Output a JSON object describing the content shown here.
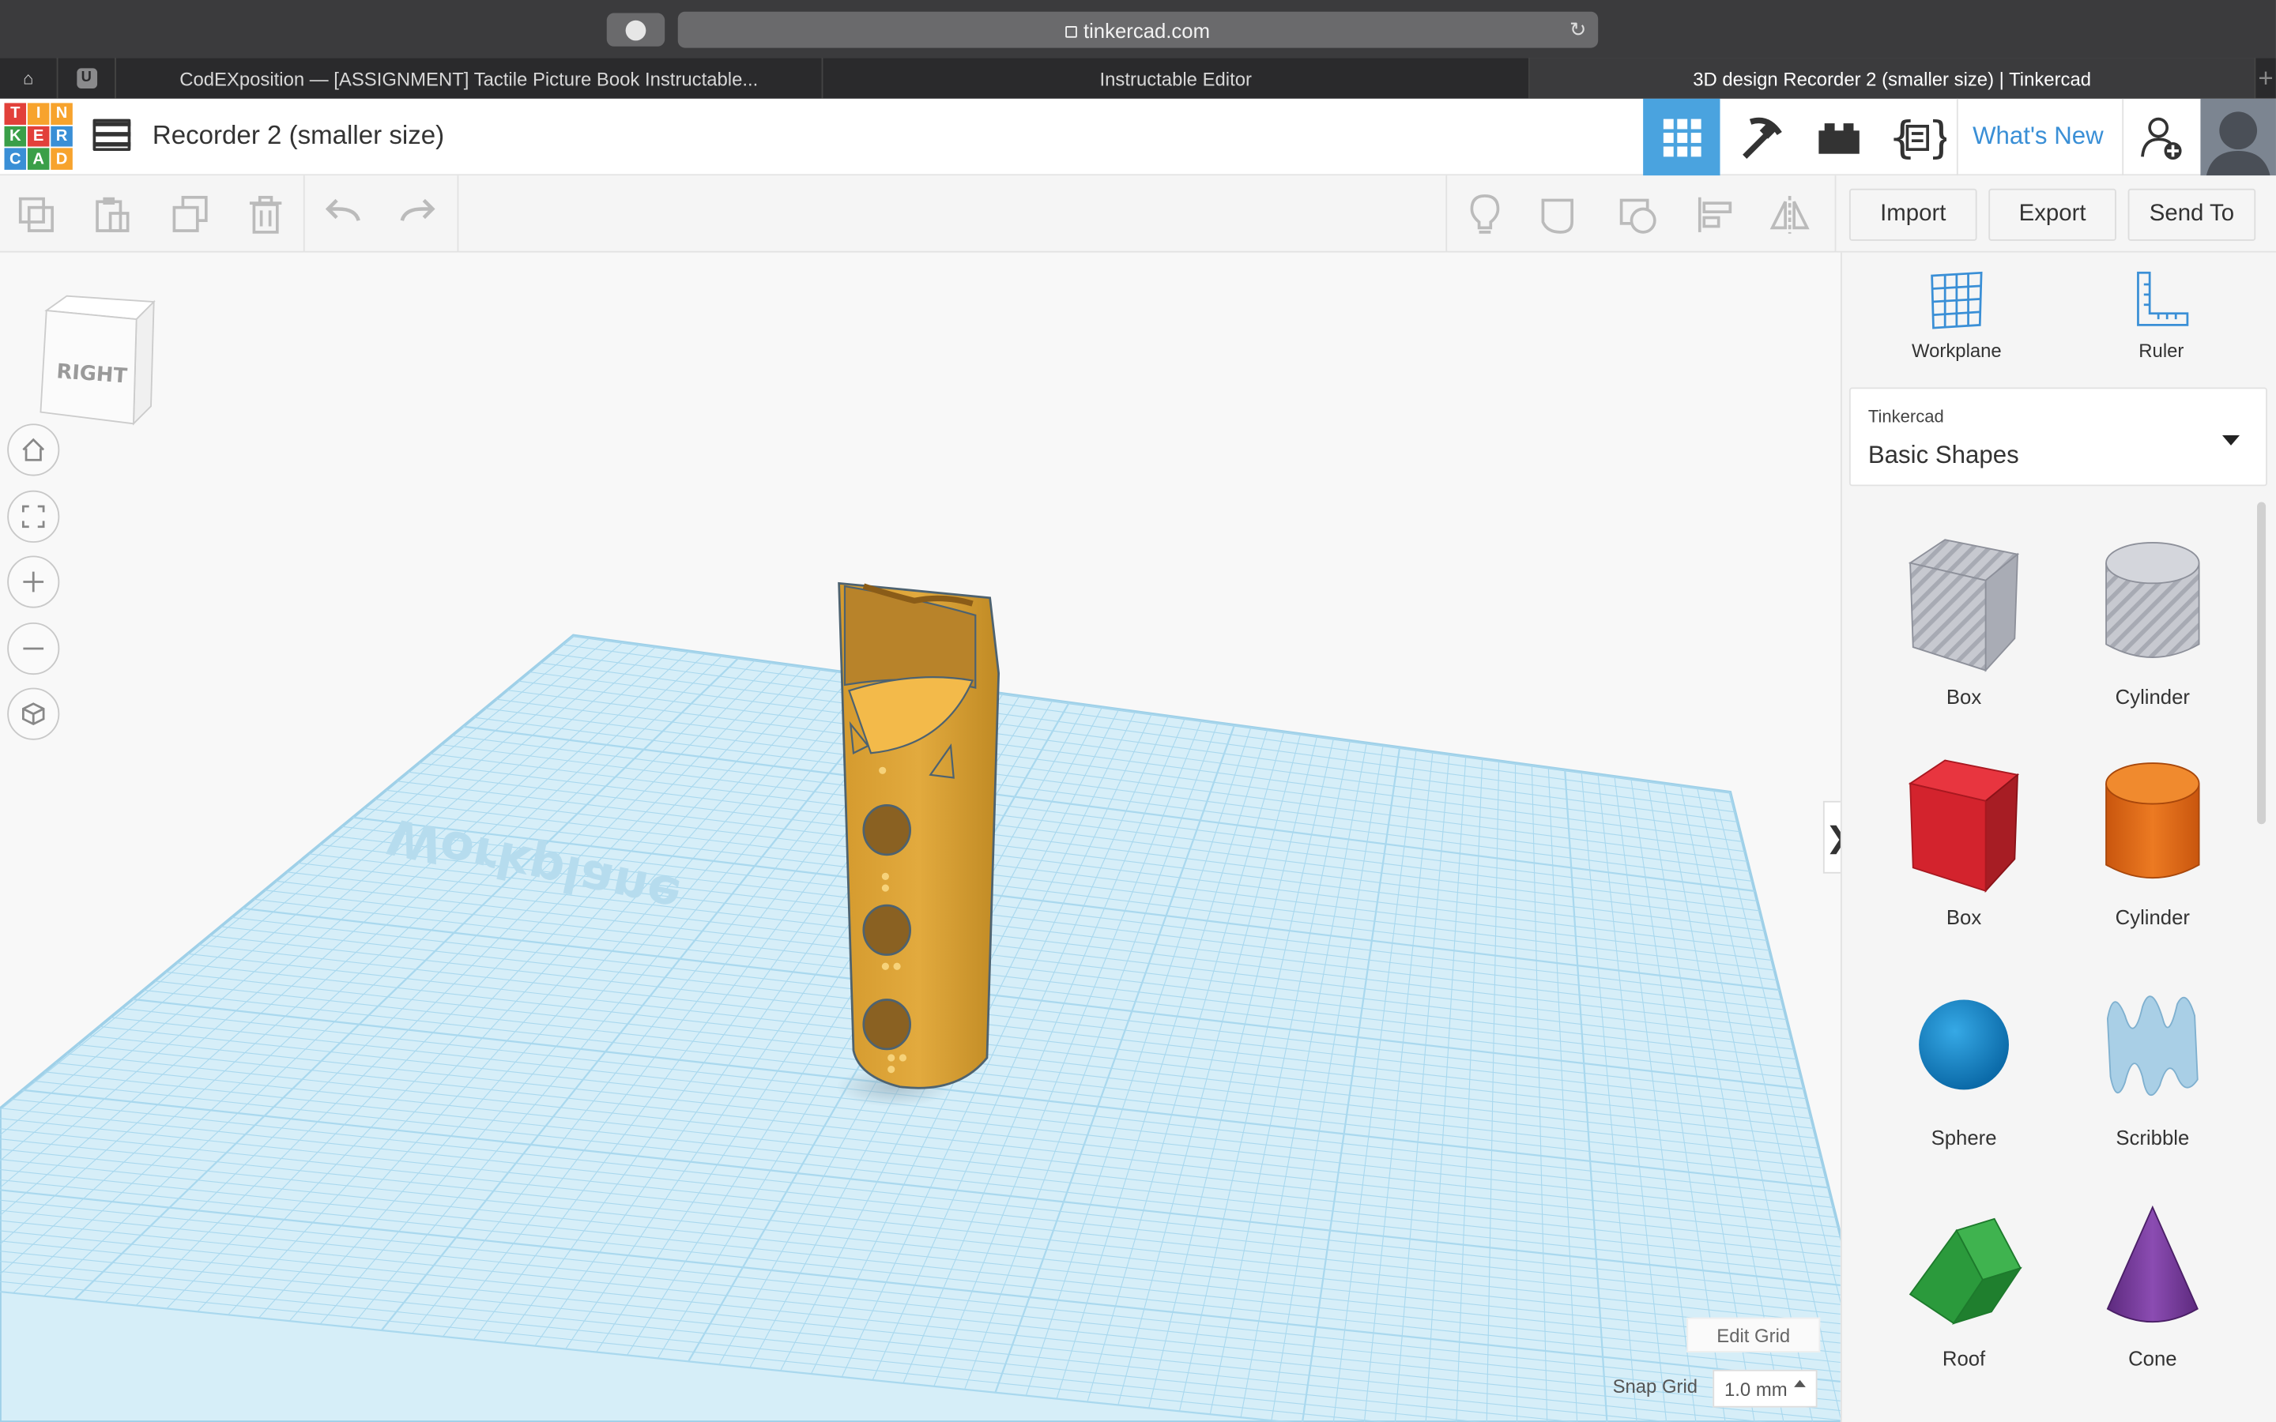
{
  "browser": {
    "url": "tinkercad.com",
    "tabs": [
      {
        "label": "CodEXposition — [ASSIGNMENT] Tactile Picture Book Instructable..."
      },
      {
        "label": "Instructable Editor"
      },
      {
        "label": "3D design Recorder 2 (smaller size) | Tinkercad"
      }
    ],
    "pinned_tab_label": "U"
  },
  "app": {
    "logo_letters": [
      "T",
      "I",
      "N",
      "K",
      "E",
      "R",
      "C",
      "A",
      "D"
    ],
    "logo_colors": [
      "#e2403a",
      "#f7a32d",
      "#f7a32d",
      "#3a9f48",
      "#e2403a",
      "#3a8fd6",
      "#3a8fd6",
      "#3a9f48",
      "#f7a32d"
    ],
    "design_title": "Recorder 2 (smaller size)",
    "whats_new": "What's New",
    "accent": "#4aa3df"
  },
  "toolbar": {
    "import_label": "Import",
    "export_label": "Export",
    "send_to_label": "Send To"
  },
  "viewport": {
    "view_cube_label": "RIGHT",
    "workplane_text": "Workplane",
    "edit_grid_label": "Edit Grid",
    "snap_grid_label": "Snap Grid",
    "snap_grid_value": "1.0 mm"
  },
  "panel": {
    "workplane_label": "Workplane",
    "ruler_label": "Ruler",
    "library_category": "Tinkercad",
    "library_name": "Basic Shapes",
    "shapes": [
      {
        "label": "Box",
        "icon": "striped-box-icon"
      },
      {
        "label": "Cylinder",
        "icon": "striped-cylinder-icon"
      },
      {
        "label": "Box",
        "icon": "red-box-icon"
      },
      {
        "label": "Cylinder",
        "icon": "orange-cylinder-icon"
      },
      {
        "label": "Sphere",
        "icon": "sphere-icon"
      },
      {
        "label": "Scribble",
        "icon": "scribble-icon"
      },
      {
        "label": "Roof",
        "icon": "roof-icon"
      },
      {
        "label": "Cone",
        "icon": "cone-icon"
      }
    ]
  }
}
